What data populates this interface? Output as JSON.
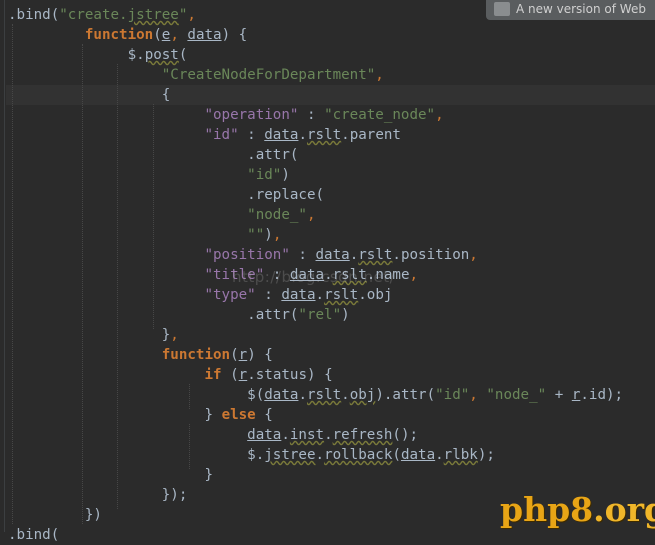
{
  "notification": {
    "text": "A new version of Web"
  },
  "watermark": "http://blog.csdn.net/",
  "logo": {
    "brand": "php8",
    "tld": ".org"
  },
  "code": {
    "l1": {
      "a": ".bind(",
      "b": "\"create.",
      "c": "jstree",
      "d": "\"",
      "e": ","
    },
    "l2": {
      "kw": "function",
      "p1": "(",
      "e": "e",
      "comma": ", ",
      "data": "data",
      "p2": ") {"
    },
    "l3": {
      "dollar": "$",
      "dot": ".",
      "post": "post",
      "p": "("
    },
    "l4": {
      "s": "\"CreateNodeForDepartment\"",
      "c": ","
    },
    "l5": {
      "t": "{"
    },
    "l6": {
      "k": "\"operation\"",
      "colon": " : ",
      "v": "\"create_node\"",
      "c": ","
    },
    "l7": {
      "k": "\"id\"",
      "colon": " : ",
      "data": "data",
      "dot1": ".",
      "rslt": "rslt",
      "dot2": ".",
      "parent": "parent"
    },
    "l8": {
      "t": ".attr("
    },
    "l9": {
      "s": "\"id\"",
      "p": ")"
    },
    "l10": {
      "t": ".replace("
    },
    "l11": {
      "s": "\"node_\"",
      "c": ","
    },
    "l12": {
      "s": "\"\"",
      "p": ")",
      "c": ","
    },
    "l13": {
      "k": "\"position\"",
      "colon": " : ",
      "data": "data",
      "dot1": ".",
      "rslt": "rslt",
      "dot2": ".",
      "v": "position",
      "c": ","
    },
    "l14": {
      "k": "\"title\"",
      "colon": " : ",
      "data": "data",
      "dot1": ".",
      "rslt": "rslt",
      "dot2": ".",
      "v": "name",
      "c": ","
    },
    "l15": {
      "k": "\"type\"",
      "colon": " : ",
      "data": "data",
      "dot1": ".",
      "rslt": "rslt",
      "dot2": ".",
      "v": "obj"
    },
    "l16": {
      "a": ".attr(",
      "s": "\"rel\"",
      "p": ")"
    },
    "l17": {
      "t": "}",
      "c": ","
    },
    "l18": {
      "kw": "function",
      "p1": "(",
      "r": "r",
      "p2": ") {"
    },
    "l19": {
      "kw": "if",
      "p1": " (",
      "r": "r",
      "dot": ".",
      "status": "status",
      "p2": ") {"
    },
    "l20": {
      "a": "$(",
      "data": "data",
      "dot1": ".",
      "rslt": "rslt",
      "dot2": ".",
      "obj": "obj",
      "b": ").attr(",
      "s1": "\"id\"",
      "comma": ", ",
      "s2": "\"node_\"",
      "plus": " + ",
      "r": "r",
      "dot3": ".",
      "id": "id",
      "end": ");"
    },
    "l21": {
      "a": "} ",
      "kw": "else",
      "b": " {"
    },
    "l22": {
      "data": "data",
      "dot1": ".",
      "inst": "inst",
      "dot2": ".",
      "refresh": "refresh",
      "end": "();"
    },
    "l23": {
      "dollar": "$",
      "dot1": ".",
      "jstree": "jstree",
      "dot2": ".",
      "rollback": "rollback",
      "p1": "(",
      "data": "data",
      "dot3": ".",
      "rlbk": "rlbk",
      "end": ");"
    },
    "l24": {
      "t": "}"
    },
    "l25": {
      "t": "});"
    },
    "l26": {
      "t": "})"
    },
    "l27": {
      "a": ".bind("
    }
  }
}
